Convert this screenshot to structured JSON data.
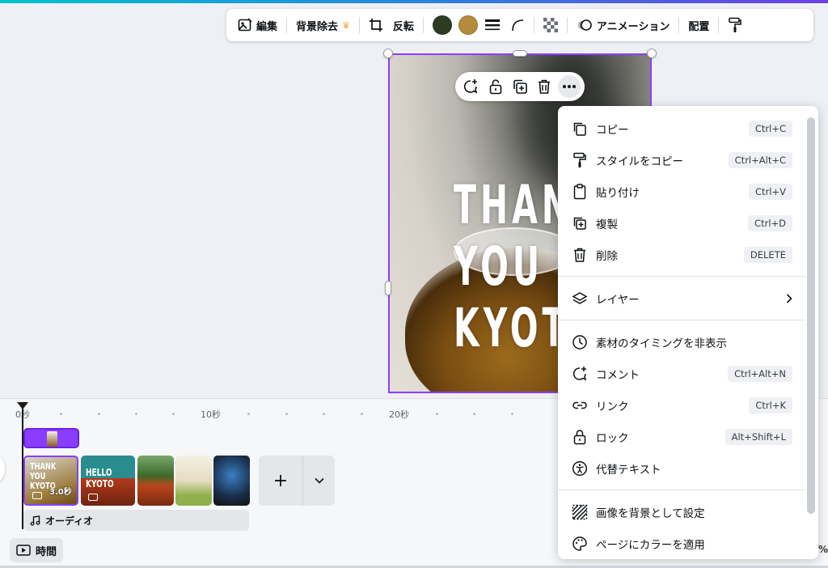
{
  "toolbar": {
    "edit_label": "編集",
    "bg_remove_label": "背景除去",
    "flip_label": "反転",
    "color1": "#2c3b22",
    "color2": "#b48a3c",
    "animation_label": "アニメーション",
    "position_label": "配置"
  },
  "artboard": {
    "text": "THANK\nYOU\nKYOTO"
  },
  "context_menu": {
    "items": [
      {
        "label": "コピー",
        "shortcut": "Ctrl+C",
        "icon": "copy-icon"
      },
      {
        "label": "スタイルをコピー",
        "shortcut": "Ctrl+Alt+C",
        "icon": "paint-roller-icon"
      },
      {
        "label": "貼り付け",
        "shortcut": "Ctrl+V",
        "icon": "clipboard-icon"
      },
      {
        "label": "複製",
        "shortcut": "Ctrl+D",
        "icon": "duplicate-icon"
      },
      {
        "label": "削除",
        "shortcut": "DELETE",
        "icon": "trash-icon"
      },
      {
        "label": "レイヤー",
        "shortcut": "",
        "icon": "layers-icon"
      },
      {
        "label": "素材のタイミングを非表示",
        "shortcut": "",
        "icon": "clock-icon"
      },
      {
        "label": "コメント",
        "shortcut": "Ctrl+Alt+N",
        "icon": "comment-icon"
      },
      {
        "label": "リンク",
        "shortcut": "Ctrl+K",
        "icon": "link-icon"
      },
      {
        "label": "ロック",
        "shortcut": "Alt+Shift+L",
        "icon": "lock-icon"
      },
      {
        "label": "代替テキスト",
        "shortcut": "",
        "icon": "accessibility-icon"
      },
      {
        "label": "画像を背景として設定",
        "shortcut": "",
        "icon": "hatch-icon"
      },
      {
        "label": "ページにカラーを適用",
        "shortcut": "",
        "icon": "palette-icon"
      }
    ]
  },
  "timeline": {
    "ruler": [
      "0秒",
      "10秒",
      "20秒"
    ],
    "scene1_text": "THANK\nYOU\nKYOTO",
    "scene1_duration": "3.0秒",
    "scene2_text": "HELLO\nKYOTO",
    "audio_label": "オーディオ",
    "time_label": "時間",
    "zoom_label": "%"
  }
}
